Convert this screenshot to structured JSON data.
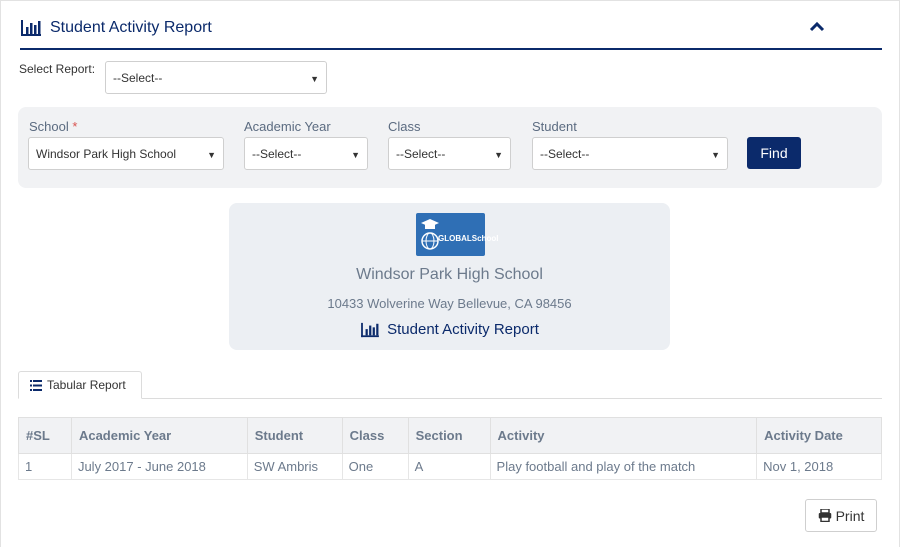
{
  "header": {
    "title": "Student Activity Report",
    "icon": "bar-chart-icon",
    "collapse_icon": "chevron-up-icon"
  },
  "select_report": {
    "label": "Select Report:",
    "value": "--Select--"
  },
  "filters": {
    "school": {
      "label": "School",
      "required_mark": "*",
      "value": "Windsor Park High School"
    },
    "academic_year": {
      "label": "Academic Year",
      "value": "--Select--"
    },
    "class": {
      "label": "Class",
      "value": "--Select--"
    },
    "student": {
      "label": "Student",
      "value": "--Select--"
    },
    "find_label": "Find",
    "dropdown_icon": "caret-down-icon"
  },
  "school_card": {
    "logo_text": "GLOBALSchool",
    "name": "Windsor Park High School",
    "address": "10433 Wolverine Way Bellevue, CA 98456",
    "report_title": "Student Activity Report"
  },
  "tabs": [
    {
      "label": "Tabular Report",
      "icon": "list-icon"
    }
  ],
  "table": {
    "columns": [
      "#SL",
      "Academic Year",
      "Student",
      "Class",
      "Section",
      "Activity",
      "Activity Date"
    ],
    "rows": [
      [
        "1",
        "July 2017 - June 2018",
        "SW Ambris",
        "One",
        "A",
        "Play football and play of the match",
        "Nov 1, 2018"
      ]
    ]
  },
  "print": {
    "label": "Print",
    "icon": "print-icon"
  },
  "colors": {
    "accent": "#0b2a6b",
    "panel_bg": "#f1f2f4",
    "muted_text": "#6c7a8c",
    "required": "#d9534f",
    "logo_bg": "#2f6fb5"
  }
}
